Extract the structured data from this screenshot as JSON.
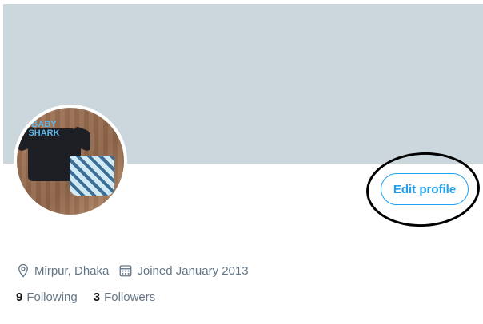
{
  "profile": {
    "edit_label": "Edit profile",
    "avatar_text": "BABY SHARK",
    "location": "Mirpur, Dhaka",
    "joined": "Joined January 2013",
    "following_count": "9",
    "following_label": "Following",
    "followers_count": "3",
    "followers_label": "Followers"
  },
  "icons": {
    "location": "location-pin-icon",
    "joined": "calendar-icon"
  },
  "colors": {
    "banner": "#ccd6dd",
    "accent": "#1da1f2",
    "secondary_text": "#657786",
    "primary_text": "#14171a"
  }
}
